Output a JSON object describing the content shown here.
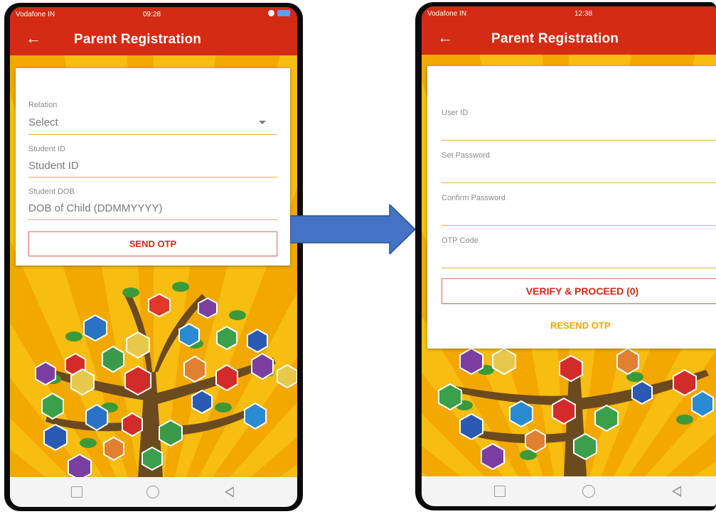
{
  "left_screen": {
    "status": {
      "carrier": "Vodafone IN",
      "time": "09:28"
    },
    "app_bar": {
      "back": "←",
      "title": "Parent Registration"
    },
    "form": {
      "relation": {
        "label": "Relation",
        "value": "Select"
      },
      "student_id": {
        "label": "Student ID",
        "placeholder": "Student ID"
      },
      "student_dob": {
        "label": "Student DOB",
        "placeholder": "DOB of Child (DDMMYYYY)"
      },
      "send_otp_button": "SEND OTP"
    }
  },
  "right_screen": {
    "status": {
      "carrier": "Vodafone IN",
      "time": "12:38"
    },
    "app_bar": {
      "back": "←",
      "title": "Parent Registration"
    },
    "form": {
      "user_id": {
        "label": "User ID"
      },
      "set_password": {
        "label": "Set Password"
      },
      "confirm_password": {
        "label": "Confirm Password"
      },
      "otp_code": {
        "label": "OTP Code"
      },
      "verify_button": "VERIFY & PROCEED (0)",
      "resend_button": "RESEND OTP"
    }
  },
  "theme": {
    "app_bar_color": "#d42b14",
    "accent_color": "#f0a800",
    "arrow_color": "#4472c4"
  },
  "icons": [
    "back-arrow-icon",
    "dropdown-caret-icon",
    "square-recents-icon",
    "circle-home-icon",
    "triangle-back-icon"
  ]
}
